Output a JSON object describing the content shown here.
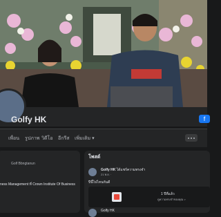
{
  "profile": {
    "name": "Golfy HK",
    "action_icon": "facebook-icon"
  },
  "nav": {
    "tabs": [
      {
        "label": "เพื่อน"
      },
      {
        "label": "รูปภาพ"
      },
      {
        "label": "วิดีโอ"
      },
      {
        "label": "อีกรีส"
      }
    ],
    "more_label": "เพิ่มเติม ▾"
  },
  "intro": {
    "line1": "Golf Bbngtanun",
    "line2": "ness Management ที่ Crown Institute Of Business"
  },
  "posts": {
    "header": "โพสต์",
    "author": "Golfy HK",
    "author_note": " ได้แชร์ความทรงจำ",
    "time": "21 พ.ย. · ",
    "text": "ปีนี้ไปไหนกันดี",
    "link_title": "1 ปีที่แล้ว",
    "link_sub": "ดูความทรงจำของคุณ >",
    "next_author": "Golfy HK"
  },
  "colors": {
    "background": "#18191a",
    "card": "#242526",
    "accent": "#1877f2"
  }
}
